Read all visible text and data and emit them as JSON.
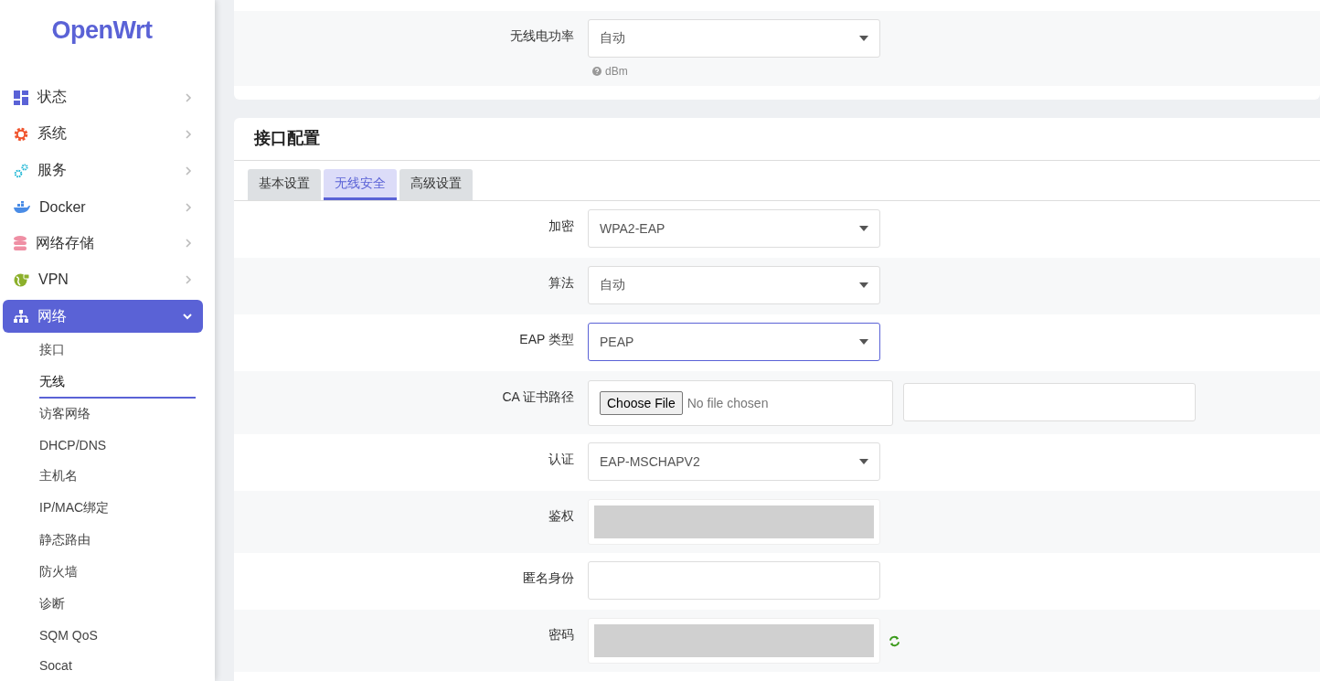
{
  "logo": "OpenWrt",
  "sidebar": {
    "items": [
      {
        "label": "状态",
        "expanded": false,
        "selected": false
      },
      {
        "label": "系统",
        "expanded": false,
        "selected": false
      },
      {
        "label": "服务",
        "expanded": false,
        "selected": false
      },
      {
        "label": "Docker",
        "expanded": false,
        "selected": false
      },
      {
        "label": "网络存储",
        "expanded": false,
        "selected": false
      },
      {
        "label": "VPN",
        "expanded": false,
        "selected": false
      },
      {
        "label": "网络",
        "expanded": true,
        "selected": true,
        "children": [
          {
            "label": "接口",
            "selected": false
          },
          {
            "label": "无线",
            "selected": true
          },
          {
            "label": "访客网络",
            "selected": false
          },
          {
            "label": "DHCP/DNS",
            "selected": false
          },
          {
            "label": "主机名",
            "selected": false
          },
          {
            "label": "IP/MAC绑定",
            "selected": false
          },
          {
            "label": "静态路由",
            "selected": false
          },
          {
            "label": "防火墙",
            "selected": false
          },
          {
            "label": "诊断",
            "selected": false
          },
          {
            "label": "SQM QoS",
            "selected": false
          },
          {
            "label": "Socat",
            "selected": false
          }
        ]
      }
    ]
  },
  "device_section": {
    "rows": [
      {
        "label": "无线电功率",
        "kind": "select",
        "value": "自动",
        "focused": false,
        "help": "dBm"
      }
    ]
  },
  "interface_section": {
    "title": "接口配置",
    "tabs": [
      {
        "label": "基本设置",
        "selected": false
      },
      {
        "label": "无线安全",
        "selected": true
      },
      {
        "label": "高级设置",
        "selected": false
      }
    ],
    "rows": [
      {
        "label": "加密",
        "kind": "select",
        "value": "WPA2-EAP",
        "focused": false
      },
      {
        "label": "算法",
        "kind": "select",
        "value": "自动",
        "focused": false
      },
      {
        "label": "EAP 类型",
        "kind": "select",
        "value": "PEAP",
        "focused": true
      },
      {
        "label": "CA 证书路径",
        "kind": "file",
        "button": "Choose File",
        "value": "No file chosen",
        "focused": false
      },
      {
        "label": "认证",
        "kind": "select",
        "value": "EAP-MSCHAPV2",
        "focused": false
      },
      {
        "label": "鉴权",
        "kind": "blocked",
        "focused": false
      },
      {
        "label": "匿名身份",
        "kind": "text",
        "focused": false
      },
      {
        "label": "密码",
        "kind": "password",
        "focused": false
      }
    ]
  }
}
